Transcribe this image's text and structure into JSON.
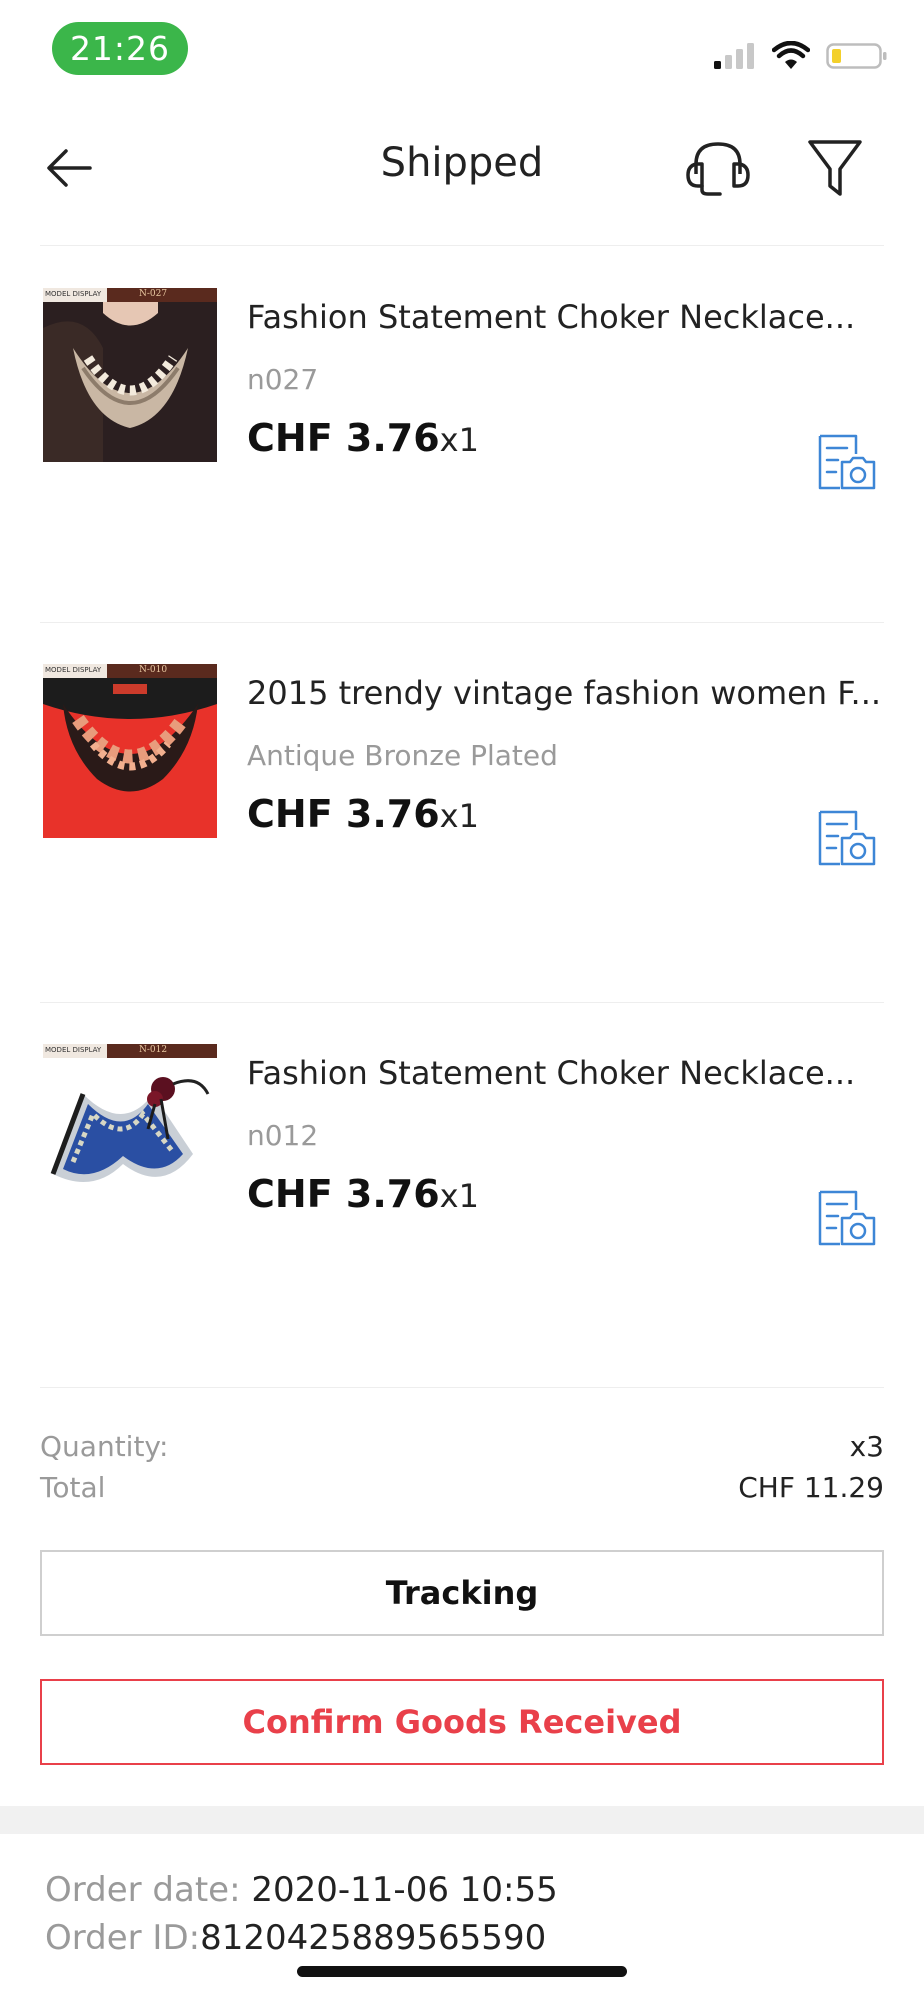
{
  "status_bar": {
    "time": "21:26"
  },
  "nav": {
    "title": "Shipped"
  },
  "items": [
    {
      "title": "Fashion Statement Choker Necklace...",
      "variant": "n027",
      "price": "CHF 3.76",
      "qty": "x1",
      "thumb_code": "N-027",
      "thumb_brand": "MODEL DISPLAY"
    },
    {
      "title": "2015 trendy vintage fashion women F...",
      "variant": "Antique Bronze Plated",
      "price": "CHF 3.76",
      "qty": "x1",
      "thumb_code": "N-010",
      "thumb_brand": "MODEL DISPLAY"
    },
    {
      "title": "Fashion Statement Choker Necklace...",
      "variant": "n012",
      "price": "CHF 3.76",
      "qty": "x1",
      "thumb_code": "N-012",
      "thumb_brand": "MODEL DISPLAY"
    }
  ],
  "summary": {
    "quantity_label": "Quantity:",
    "quantity_value": "x3",
    "total_label": "Total",
    "total_value": "CHF 11.29"
  },
  "buttons": {
    "tracking": "Tracking",
    "confirm": "Confirm Goods Received"
  },
  "order": {
    "date_label": "Order date:",
    "date_value": " 2020-11-06 10:55",
    "id_label": "Order ID:",
    "id_value": "8120425889565590"
  },
  "colors": {
    "accent_red": "#e9404a",
    "status_green": "#3bb64a",
    "icon_blue": "#3d86d6"
  }
}
